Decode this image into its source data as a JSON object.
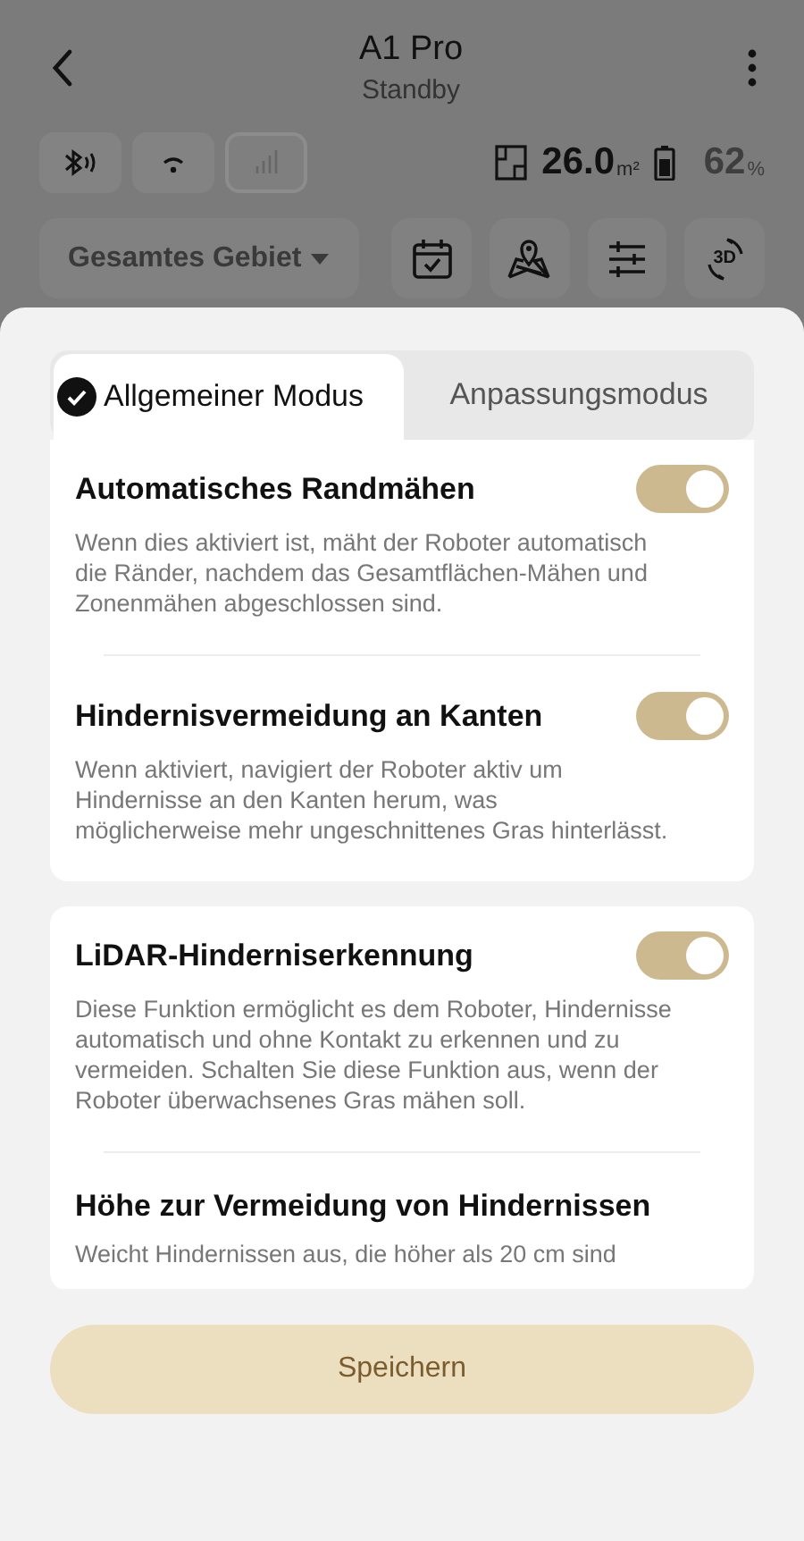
{
  "header": {
    "title": "A1 Pro",
    "status": "Standby"
  },
  "connections": [
    {
      "kind": "bluetooth",
      "on": true
    },
    {
      "kind": "wifi",
      "on": true
    },
    {
      "kind": "cellular",
      "on": false
    }
  ],
  "area": {
    "value": "26.0",
    "unit": "m²"
  },
  "battery": {
    "value": "62",
    "unit": "%"
  },
  "zone_select": {
    "label": "Gesamtes Gebiet"
  },
  "tools": [
    {
      "kind": "calendar"
    },
    {
      "kind": "map"
    },
    {
      "kind": "sliders"
    },
    {
      "kind": "view3d",
      "label": "3D"
    }
  ],
  "tabs": [
    {
      "label": "Allgemeiner Modus",
      "selected": true
    },
    {
      "label": "Anpassungsmodus",
      "selected": false
    }
  ],
  "cards": [
    {
      "items": [
        {
          "kind": "toggle",
          "title": "Automatisches Randmähen",
          "description": "Wenn dies aktiviert ist, mäht der Roboter automatisch die Ränder, nachdem das Gesamtflächen-Mähen und Zonenmähen abgeschlossen sind.",
          "on": true
        },
        {
          "kind": "toggle",
          "title": "Hindernisvermeidung an Kanten",
          "description": "Wenn aktiviert, navigiert der Roboter aktiv um Hindernisse an den Kanten herum, was möglicherweise mehr ungeschnittenes Gras hinterlässt.",
          "on": true
        }
      ]
    },
    {
      "items": [
        {
          "kind": "toggle",
          "title": "LiDAR-Hinderniserkennung",
          "description": "Diese Funktion ermöglicht es dem Roboter, Hindernisse automatisch und ohne Kontakt zu erkennen und zu vermeiden. Schalten Sie diese Funktion aus, wenn der Roboter überwachsenes Gras mähen soll.",
          "on": true
        },
        {
          "kind": "info",
          "title": "Höhe zur Vermeidung von Hindernissen",
          "description": "Weicht Hindernissen aus, die höher als 20 cm sind"
        }
      ]
    }
  ],
  "save_button": {
    "label": "Speichern"
  }
}
